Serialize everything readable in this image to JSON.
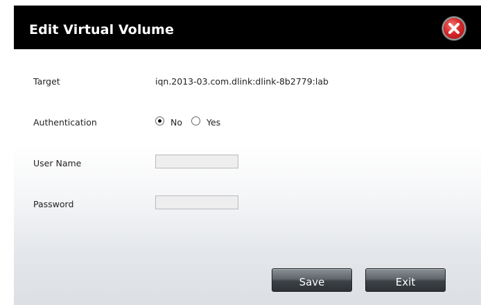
{
  "dialog": {
    "title": "Edit Virtual Volume",
    "close_icon": "close-icon"
  },
  "form": {
    "target": {
      "label": "Target",
      "value": "iqn.2013-03.com.dlink:dlink-8b2779:lab"
    },
    "authentication": {
      "label": "Authentication",
      "options": [
        {
          "label": "No",
          "selected": true
        },
        {
          "label": "Yes",
          "selected": false
        }
      ]
    },
    "username": {
      "label": "User Name",
      "value": ""
    },
    "password": {
      "label": "Password",
      "value": ""
    }
  },
  "buttons": {
    "save_label": "Save",
    "exit_label": "Exit"
  },
  "colors": {
    "titlebar": "#000000",
    "close": "#d8282a"
  }
}
